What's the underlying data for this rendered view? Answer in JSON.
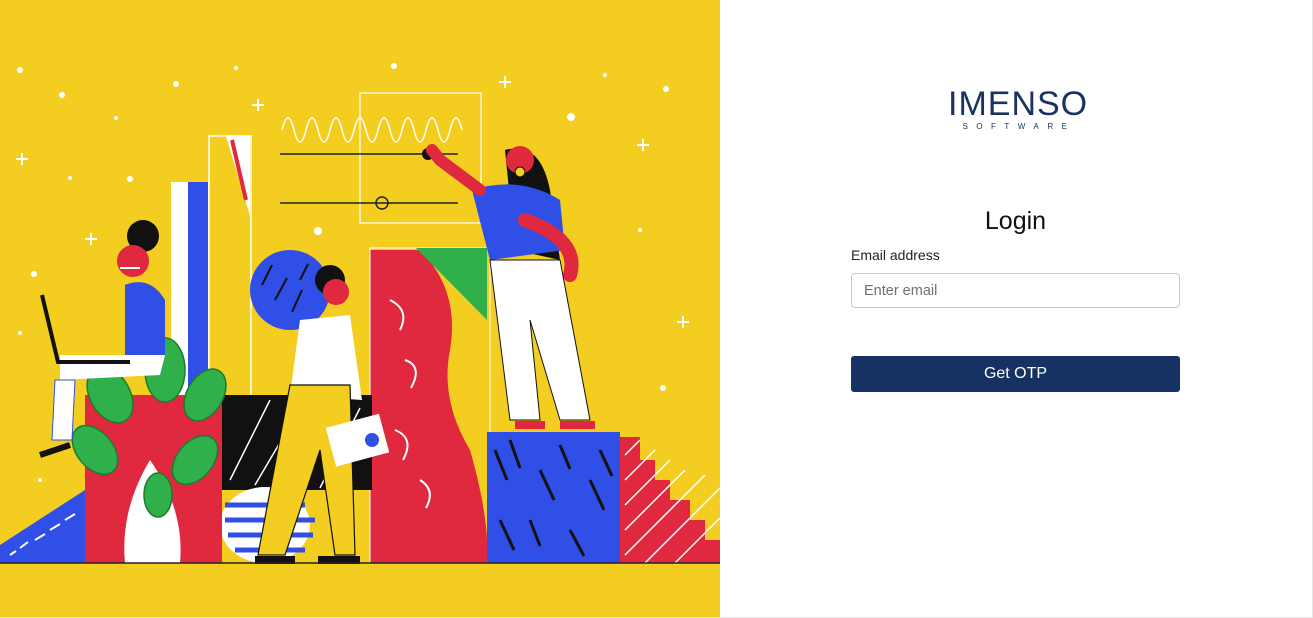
{
  "brand": {
    "name": "IMENSO",
    "tagline": "SOFTWARE"
  },
  "login": {
    "title": "Login",
    "email_label": "Email address",
    "email_placeholder": "Enter email",
    "email_value": "",
    "submit_label": "Get OTP"
  },
  "colors": {
    "illustration_background": "#f3cd1f",
    "brand_navy": "#163263",
    "accent_red": "#e0283f",
    "accent_blue": "#2f4fe6",
    "accent_green": "#2fb04a"
  },
  "illustration": {
    "subject": "team-collaboration-illustration"
  }
}
